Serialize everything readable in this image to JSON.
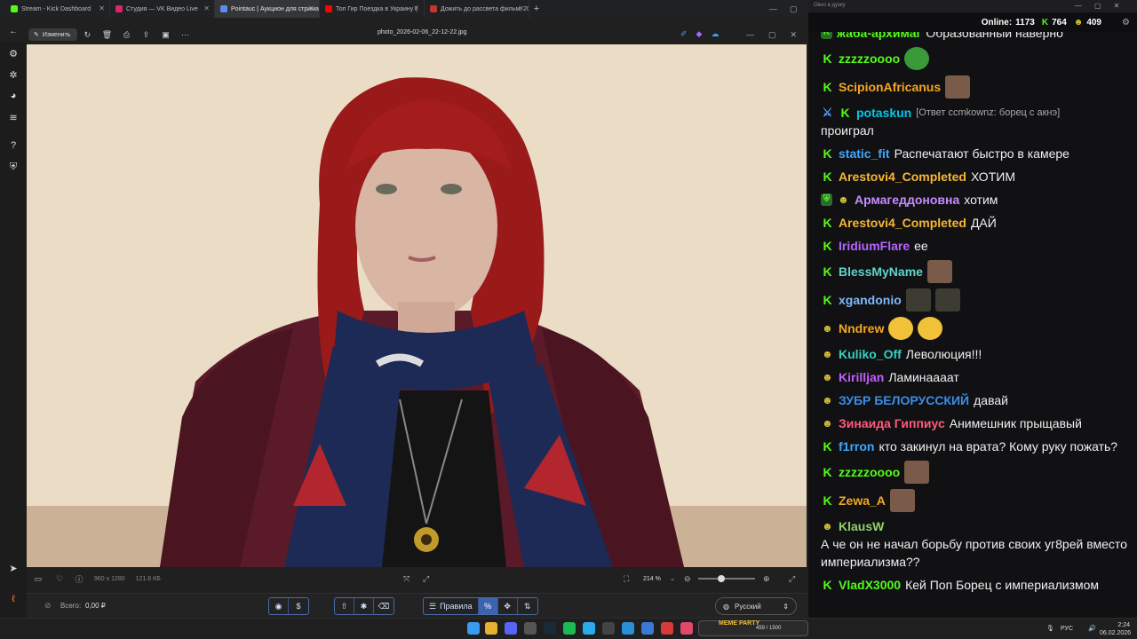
{
  "browser": {
    "tabs": [
      {
        "label": "Stream - Kick Dashboard",
        "color": "#53fc18",
        "active": false
      },
      {
        "label": "Студия — VK Видео Live",
        "color": "#e0245e",
        "active": false
      },
      {
        "label": "Pointauc | Аукцион для стрима",
        "color": "#5b8def",
        "active": true
      },
      {
        "label": "Топ Гир Поездка в Украину (",
        "color": "#ff0000",
        "active": false
      },
      {
        "label": "Дожить до рассвета фильм, 20",
        "color": "#c0392b",
        "active": false
      }
    ],
    "new_tab": "+"
  },
  "viewer": {
    "edit_label": "Изменить",
    "filename": "photo_2026-02-06_22-12-22.jpg",
    "status": {
      "dimensions": "960 x 1280",
      "filesize": "121.6 КБ",
      "zoom": "214 %",
      "zoom_level": 0.4
    }
  },
  "auction": {
    "total_label": "Всего:",
    "total_value": "0,00 ₽",
    "rules_label": "Правила",
    "language": "Русский",
    "percent_icon": "%"
  },
  "chat": {
    "window_title": "Окно в дуэку",
    "online_label": "Online:",
    "online_count": "1173",
    "kick_count": "764",
    "vk_count": "409",
    "messages": [
      {
        "badges": [
          "sub"
        ],
        "user": "жаба-архимаг",
        "color": "#53fc18",
        "text": "Образованный наверно",
        "emotes": [],
        "inline": true
      },
      {
        "badges": [
          "kick"
        ],
        "user": "zzzzzoooo",
        "color": "#53fc18",
        "text": "",
        "emotes": [
          "pepe"
        ],
        "inline": true
      },
      {
        "badges": [
          "kick"
        ],
        "user": "ScipionAfricanus",
        "color": "#f5a623",
        "text": "",
        "emotes": [
          "face"
        ],
        "inline": true
      },
      {
        "badges": [
          "sword",
          "kick"
        ],
        "user": "potaskun",
        "color": "#00c8e8",
        "reply": "[Ответ ccmkownz: борец с акнэ]",
        "text": "проиграл",
        "emotes": [],
        "inline": false
      },
      {
        "badges": [
          "kick"
        ],
        "user": "static_fit",
        "color": "#3ea8ff",
        "text": "Распечатают быстро в камере",
        "emotes": [],
        "inline": true
      },
      {
        "badges": [
          "kick"
        ],
        "user": "Arestovi4_Completed",
        "color": "#f7b733",
        "text": "ХОТИМ",
        "emotes": [],
        "inline": true
      },
      {
        "badges": [
          "shield",
          "face"
        ],
        "user": "Армагеддоновна",
        "color": "#c68cff",
        "text": "хотим",
        "emotes": [],
        "inline": true
      },
      {
        "badges": [
          "kick"
        ],
        "user": "Arestovi4_Completed",
        "color": "#f7b733",
        "text": "ДАЙ",
        "emotes": [],
        "inline": true
      },
      {
        "badges": [
          "kick"
        ],
        "user": "IridiumFlare",
        "color": "#b565ff",
        "text": "ее",
        "emotes": [],
        "inline": true
      },
      {
        "badges": [
          "kick"
        ],
        "user": "BlessMyName",
        "color": "#5fd4c8",
        "text": "",
        "emotes": [
          "face"
        ],
        "inline": true
      },
      {
        "badges": [
          "kick"
        ],
        "user": "xgandonio",
        "color": "#7fb8ff",
        "text": "",
        "emotes": [
          "dark",
          "dark"
        ],
        "inline": true
      },
      {
        "badges": [
          "face"
        ],
        "user": "Nndrew",
        "color": "#f5a623",
        "text": "",
        "emotes": [
          "laugh",
          "laugh"
        ],
        "inline": true
      },
      {
        "badges": [
          "face"
        ],
        "user": "Kuliko_Off",
        "color": "#35d0c0",
        "text": "Леволюция!!!",
        "emotes": [],
        "inline": true
      },
      {
        "badges": [
          "face"
        ],
        "user": "Kirilljan",
        "color": "#c45cff",
        "text": "Ламинаааат",
        "emotes": [],
        "inline": true
      },
      {
        "badges": [
          "face"
        ],
        "user": "ЗУБР БЕЛОРУССКИЙ",
        "color": "#3a8ee6",
        "text": "давай",
        "emotes": [],
        "inline": true
      },
      {
        "badges": [
          "face"
        ],
        "user": "Зинаида Гиппиус",
        "color": "#ff5a7a",
        "text": "Анимешник прыщавый",
        "emotes": [],
        "inline": true
      },
      {
        "badges": [
          "kick"
        ],
        "user": "f1rron",
        "color": "#3ea8ff",
        "text": "кто закинул на врата? Кому руку пожать?",
        "emotes": [],
        "inline": true
      },
      {
        "badges": [
          "kick"
        ],
        "user": "zzzzzoooo",
        "color": "#53fc18",
        "text": "",
        "emotes": [
          "face"
        ],
        "inline": true
      },
      {
        "badges": [
          "kick"
        ],
        "user": "Zewa_A",
        "color": "#f5a623",
        "text": "",
        "emotes": [
          "face"
        ],
        "inline": true
      },
      {
        "badges": [
          "face"
        ],
        "user": "KlausW",
        "color": "#8fd16a",
        "text": "А че он не начал борьбу против своих уг8рей вместо империализма??",
        "emotes": [],
        "inline": true
      },
      {
        "badges": [
          "kick"
        ],
        "user": "VladX3000",
        "color": "#53fc18",
        "text": "Кей Поп Борец с империализмом",
        "emotes": [],
        "inline": true
      }
    ]
  },
  "taskbar": {
    "widget_label": "MEME PARTY",
    "widget_counter": "459 / 1500",
    "lang": "РУС",
    "time": "2:24",
    "date": "06.02.2026"
  }
}
